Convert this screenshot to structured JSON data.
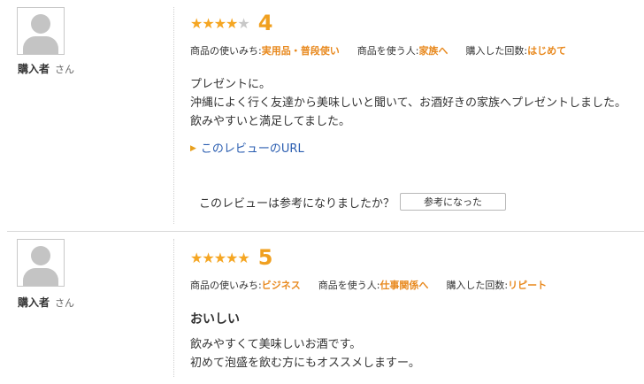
{
  "reviews": [
    {
      "reviewer_name": "購入者",
      "reviewer_suffix": "さん",
      "stars_on": "★★★★",
      "stars_off": "★",
      "rating": 4,
      "rating_text": "4",
      "meta": [
        {
          "label": "商品の使いみち:",
          "value": "実用品・普段使い"
        },
        {
          "label": "商品を使う人:",
          "value": "家族へ"
        },
        {
          "label": "購入した回数:",
          "value": "はじめて"
        }
      ],
      "body_lines": [
        "プレゼントに。",
        "沖縄によく行く友達から美味しいと聞いて、お酒好きの家族へプレゼントしました。",
        "飲みやすいと満足してました。"
      ],
      "url_link": "このレビューのURL",
      "helpful_question": "このレビューは参考になりましたか？",
      "helpful_button": "参考になった"
    },
    {
      "reviewer_name": "購入者",
      "reviewer_suffix": "さん",
      "stars_on": "★★★★★",
      "stars_off": "",
      "rating": 5,
      "rating_text": "5",
      "meta": [
        {
          "label": "商品の使いみち:",
          "value": "ビジネス"
        },
        {
          "label": "商品を使う人:",
          "value": "仕事関係へ"
        },
        {
          "label": "購入した回数:",
          "value": "リピート"
        }
      ],
      "headline": "おいしい",
      "body_lines": [
        "飲みやすくて美味しいお酒です。",
        "初めて泡盛を飲む方にもオススメしますー。"
      ]
    }
  ],
  "colors": {
    "star": "#f5a623",
    "star_off": "#c8c8c8",
    "score": "#f0a020",
    "meta_value": "#e8891e",
    "link": "#2a5db0"
  }
}
